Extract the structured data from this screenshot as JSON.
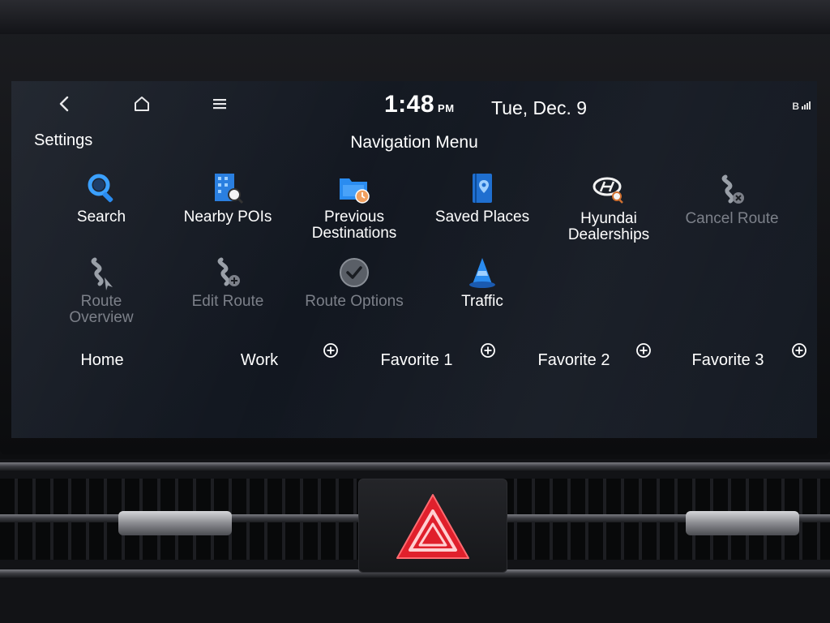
{
  "header": {
    "time": "1:48",
    "ampm": "PM",
    "date": "Tue, Dec. 9",
    "bluetooth_label": "B"
  },
  "screen": {
    "settings_label": "Settings",
    "title": "Navigation Menu"
  },
  "menu": [
    {
      "label": "Search",
      "icon": "search-icon",
      "enabled": true
    },
    {
      "label": "Nearby POIs",
      "icon": "nearby-pois-icon",
      "enabled": true
    },
    {
      "label": "Previous\nDestinations",
      "icon": "previous-destinations-icon",
      "enabled": true
    },
    {
      "label": "Saved Places",
      "icon": "saved-places-icon",
      "enabled": true
    },
    {
      "label": "Hyundai\nDealerships",
      "icon": "hyundai-dealerships-icon",
      "enabled": true
    },
    {
      "label": "Cancel Route",
      "icon": "cancel-route-icon",
      "enabled": false
    },
    {
      "label": "Route\nOverview",
      "icon": "route-overview-icon",
      "enabled": false
    },
    {
      "label": "Edit Route",
      "icon": "edit-route-icon",
      "enabled": false
    },
    {
      "label": "Route Options",
      "icon": "route-options-icon",
      "enabled": false
    },
    {
      "label": "Traffic",
      "icon": "traffic-icon",
      "enabled": true
    }
  ],
  "favorites": [
    {
      "label": "Home"
    },
    {
      "label": "Work"
    },
    {
      "label": "Favorite 1"
    },
    {
      "label": "Favorite 2"
    },
    {
      "label": "Favorite 3"
    }
  ],
  "colors": {
    "accent_blue": "#2a8cf0",
    "disabled_gray": "#7c8089",
    "hazard_red": "#e0202c"
  }
}
